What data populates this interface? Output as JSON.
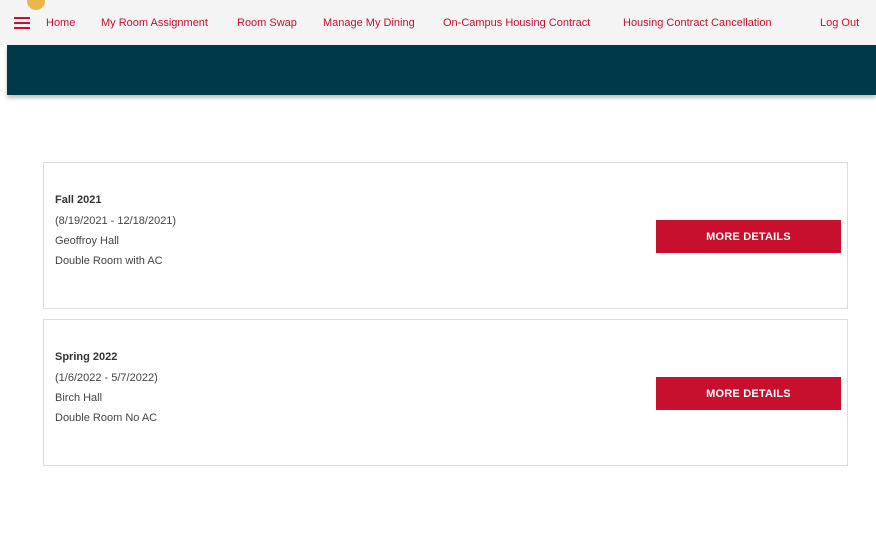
{
  "nav": {
    "items": [
      {
        "label": "Home"
      },
      {
        "label": "My Room Assignment"
      },
      {
        "label": "Room Swap"
      },
      {
        "label": "Manage My Dining"
      },
      {
        "label": "On-Campus Housing Contract"
      },
      {
        "label": "Housing Contract Cancellation"
      },
      {
        "label": "Log Out"
      }
    ],
    "menu_icon": "hamburger-menu-icon"
  },
  "colors": {
    "accent": "#c8102e",
    "banner": "#003a4a",
    "nav_background": "#f4f4f4",
    "notification": "#e8b84a"
  },
  "assignments": [
    {
      "term": "Fall 2021",
      "dates": "(8/19/2021 - 12/18/2021)",
      "hall": "Geoffroy Hall",
      "room": "Double Room with AC",
      "button_label": "MORE DETAILS"
    },
    {
      "term": "Spring 2022",
      "dates": "(1/6/2022 - 5/7/2022)",
      "hall": "Birch Hall",
      "room": "Double Room No AC",
      "button_label": "MORE DETAILS"
    }
  ]
}
